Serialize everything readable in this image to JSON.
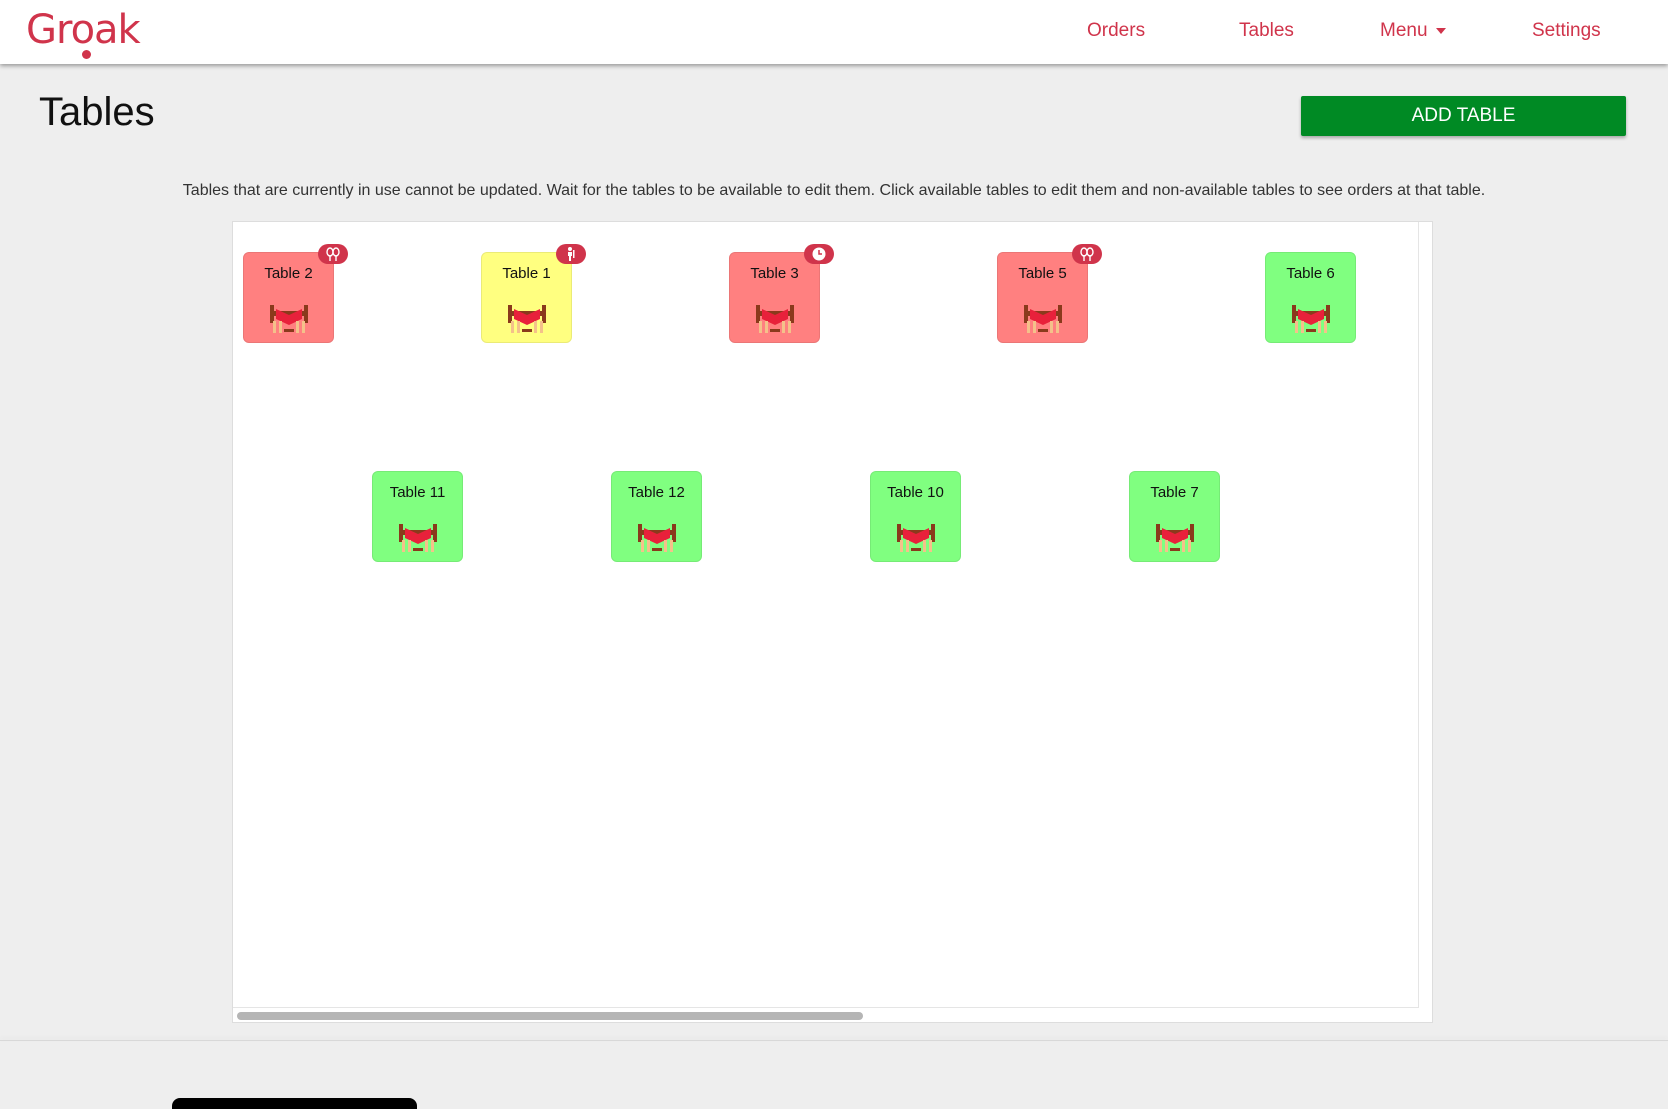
{
  "app": {
    "logo_text": "Groak"
  },
  "nav": {
    "orders": "Orders",
    "tables": "Tables",
    "menu": "Menu",
    "settings": "Settings"
  },
  "page": {
    "title": "Tables",
    "add_button": "ADD TABLE",
    "info": "Tables that are currently in use cannot be updated. Wait for the tables to be available to edit them. Click available tables to edit them and non-available tables to see orders at that table."
  },
  "colors": {
    "brand": "#d0344b",
    "add_button": "#008a24",
    "occupied": "#ff8080",
    "waiting": "#ffff80",
    "available": "#80ff80"
  },
  "tables": [
    {
      "label": "Table 2",
      "status": "occupied",
      "badge_icon": "cutlery-icon"
    },
    {
      "label": "Table 1",
      "status": "waiting",
      "badge_icon": "waiter-icon"
    },
    {
      "label": "Table 3",
      "status": "occupied",
      "badge_icon": "clock-icon"
    },
    {
      "label": "Table 5",
      "status": "occupied",
      "badge_icon": "cutlery-icon"
    },
    {
      "label": "Table 6",
      "status": "available",
      "badge_icon": null
    },
    {
      "label": "Table 11",
      "status": "available",
      "badge_icon": null
    },
    {
      "label": "Table 12",
      "status": "available",
      "badge_icon": null
    },
    {
      "label": "Table 10",
      "status": "available",
      "badge_icon": null
    },
    {
      "label": "Table 7",
      "status": "available",
      "badge_icon": null
    }
  ]
}
